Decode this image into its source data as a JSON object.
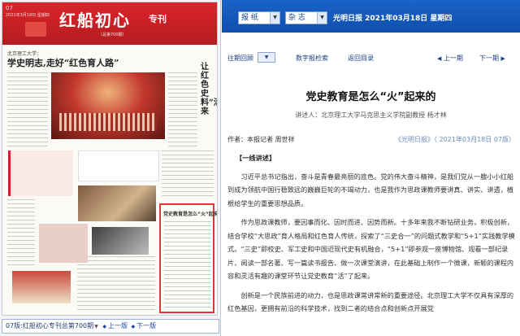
{
  "paper": {
    "page_no": "07",
    "page_date": "2021年3月18日 星期四",
    "masthead_title": "红船初心",
    "masthead_sub": "专刊",
    "masthead_editor": "（总第700期）",
    "kicker": "北京理工大学：",
    "headline": "学史明志,走好“红色育人路”",
    "vertical_title": "让红色史料“活”起来",
    "hotbox_label": "一线讲述",
    "hotbox_title": "党史教育是怎么“火”起来的"
  },
  "pagenav": {
    "page_label": "07版:红船初心专刊总第700期",
    "prev_page": "上一版",
    "next_page": "下一版"
  },
  "topbar": {
    "paper_select": "报 纸",
    "type_select": "杂 志",
    "paper_name": "光明日报",
    "date": "2021年03月18日",
    "weekday": "星期四"
  },
  "toolbar": {
    "past_issues": "往期回顾",
    "digital_search": "数字报检索",
    "back_to_contents": "返回目录",
    "prev": "上一期",
    "next": "下一期"
  },
  "article": {
    "title": "党史教育是怎么“火”起来的",
    "subtitle": "讲述人：北京理工大学马克思主义学院副教授 杨才林",
    "byline": "作者：本报记者 周世祥",
    "source": "《光明日报》（ 2021年03月18日 07版）",
    "section_head": "【一线讲述】",
    "p1": "习近平总书记指出，奋斗是青春最亮丽的底色。党的伟大奋斗精神，是我们党从一艘小小红船到成为领航中国行稳致远的巍巍巨轮的不竭动力，也是我作为思政课教师要讲真、讲实、讲透，植根给学生的重要思想品质。",
    "p2": "作为思政课教师，要因事而化、因时而进、因势而新。十多年来我不断钻研业务，积极创新，结合学校“大思政”育人格局和红色育人传统，探索了“三史合一”的问题式教学和“5+1”实践教学模式。“三史”即校史、军工史和中国近现代史有机融合，“5+1”即参观一座博物馆、观看一部纪录片、阅读一部名著、写一篇读书报告、做一次课堂演讲，在此基础上制作一个微课，新颖的课程内容和灵活有趣的课堂环节让党史教育“活”了起来。",
    "p3": "创新是一个民族前进的动力，也是思政课常讲常新的重要途径。北京理工大学不仅具有深厚的红色基因，更拥有前沿的科学技术，找到二者的结合点和创新点开展党"
  },
  "colors": {
    "topbar": "#1a63c7",
    "masthead": "#d9252a",
    "link": "#1d3f86",
    "source": "#6a8bb7"
  }
}
